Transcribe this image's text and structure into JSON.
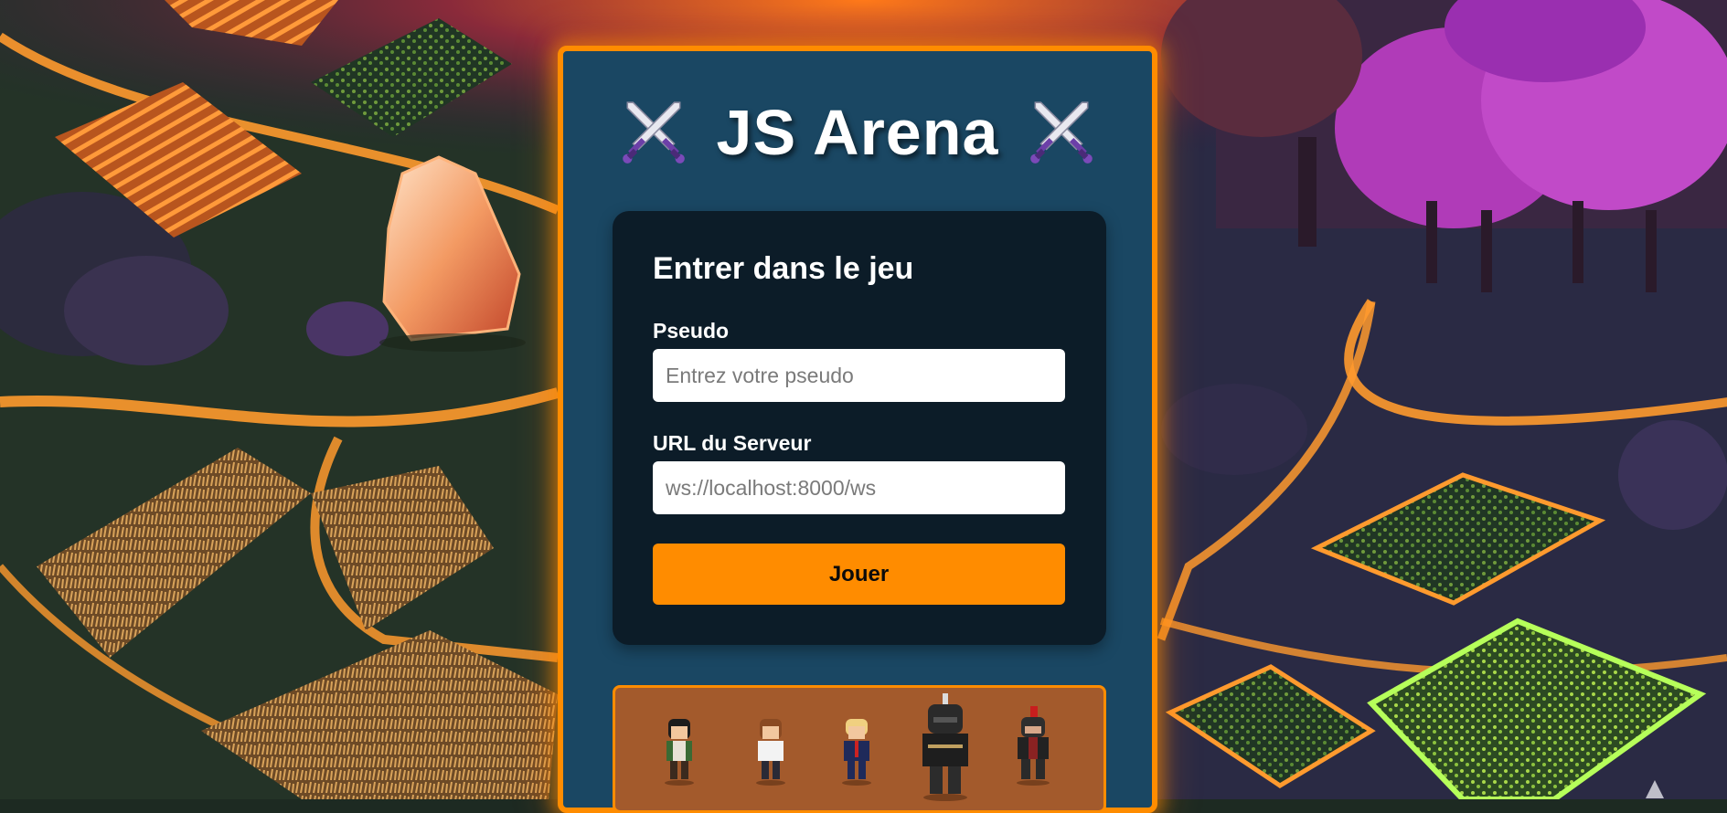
{
  "app": {
    "title": "JS Arena",
    "title_icon": "crossed-swords-icon"
  },
  "login": {
    "heading": "Entrer dans le jeu",
    "pseudo_label": "Pseudo",
    "pseudo_placeholder": "Entrez votre pseudo",
    "pseudo_value": "",
    "server_label": "URL du Serveur",
    "server_placeholder": "ws://localhost:8000/ws",
    "server_value": "",
    "play_label": "Jouer"
  },
  "characters": [
    {
      "name": "character-dark-hair-green-cape"
    },
    {
      "name": "character-brown-hair-white-shirt"
    },
    {
      "name": "character-blond-navy-suit"
    },
    {
      "name": "character-black-armored-knight"
    },
    {
      "name": "character-red-plume-warrior"
    }
  ],
  "colors": {
    "accent": "#ff8c00",
    "panel": "#1a4763",
    "card": "#0c1c28",
    "character_box": "#a35a2c"
  }
}
